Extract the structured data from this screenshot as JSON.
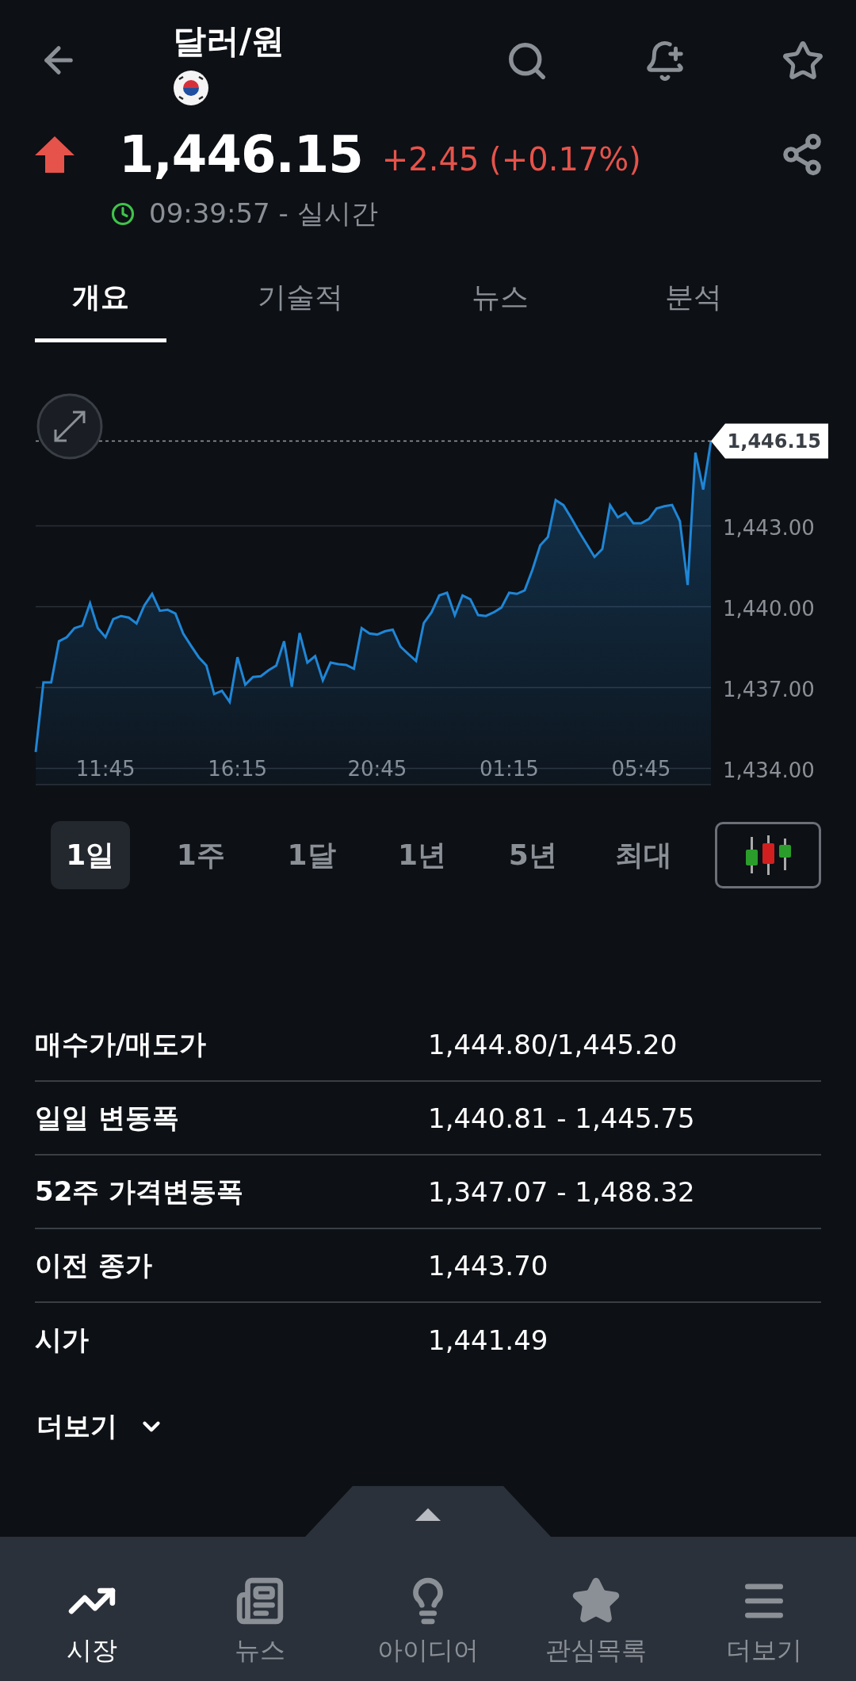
{
  "header": {
    "title": "달러/원"
  },
  "quote": {
    "rising": true,
    "price": "1,446.15",
    "change": "+2.45 (+0.17%)",
    "time": "09:39:57 - 실시간"
  },
  "tabs": [
    {
      "label": "개요",
      "selected": true
    },
    {
      "label": "기술적",
      "selected": false
    },
    {
      "label": "뉴스",
      "selected": false
    },
    {
      "label": "분석",
      "selected": false
    }
  ],
  "chart": {
    "price_tag": "1,446.15",
    "chart_data": {
      "type": "area",
      "grid": true,
      "ylim": [
        1433.4,
        1446.15
      ],
      "categories": [
        null,
        null,
        null,
        null,
        null,
        null,
        null,
        null,
        null,
        "11:45",
        null,
        null,
        null,
        null,
        null,
        null,
        null,
        null,
        null,
        null,
        null,
        null,
        null,
        null,
        null,
        null,
        "16:15",
        null,
        null,
        null,
        null,
        null,
        null,
        null,
        null,
        null,
        null,
        null,
        null,
        null,
        null,
        null,
        null,
        null,
        "20:45",
        null,
        null,
        null,
        null,
        null,
        null,
        null,
        null,
        null,
        null,
        null,
        null,
        null,
        null,
        null,
        null,
        "01:15",
        null,
        null,
        null,
        null,
        null,
        null,
        null,
        null,
        null,
        null,
        null,
        null,
        null,
        null,
        null,
        null,
        "05:45",
        null,
        null,
        null,
        null,
        null,
        null,
        null,
        null,
        null
      ],
      "yticks": [
        {
          "value": 1434,
          "label": "1,434.00"
        },
        {
          "value": 1437,
          "label": "1,437.00"
        },
        {
          "value": 1440,
          "label": "1,440.00"
        },
        {
          "value": 1443,
          "label": "1,443.00"
        }
      ],
      "series": [
        {
          "color": "#1f86d6",
          "values": [
            1434.61,
            1437.19,
            1437.19,
            1438.72,
            1438.87,
            1439.21,
            1439.3,
            1440.13,
            1439.21,
            1438.87,
            1439.54,
            1439.66,
            1439.6,
            1439.38,
            1440.05,
            1440.48,
            1439.85,
            1439.89,
            1439.75,
            1439.01,
            1438.56,
            1438.13,
            1437.82,
            1436.76,
            1436.88,
            1436.47,
            1438.13,
            1437.11,
            1437.39,
            1437.42,
            1437.64,
            1437.82,
            1438.72,
            1437.03,
            1439.03,
            1437.93,
            1438.17,
            1437.27,
            1437.93,
            1437.87,
            1437.84,
            1437.7,
            1439.21,
            1439.01,
            1438.97,
            1439.09,
            1439.15,
            1438.52,
            1438.25,
            1437.99,
            1439.4,
            1439.79,
            1440.42,
            1440.52,
            1439.69,
            1440.42,
            1440.28,
            1439.69,
            1439.66,
            1439.79,
            1439.97,
            1440.52,
            1440.48,
            1440.61,
            1441.38,
            1442.28,
            1442.59,
            1443.96,
            1443.77,
            1443.3,
            1442.79,
            1442.32,
            1441.85,
            1442.14,
            1443.77,
            1443.32,
            1443.49,
            1443.1,
            1443.1,
            1443.26,
            1443.65,
            1443.73,
            1443.78,
            1443.18,
            1440.81,
            1445.72,
            1444.35,
            1446.15
          ]
        }
      ]
    }
  },
  "ranges": [
    {
      "label": "1일",
      "selected": true
    },
    {
      "label": "1주",
      "selected": false
    },
    {
      "label": "1달",
      "selected": false
    },
    {
      "label": "1년",
      "selected": false
    },
    {
      "label": "5년",
      "selected": false
    },
    {
      "label": "최대",
      "selected": false
    }
  ],
  "stats": [
    {
      "label": "매수가/매도가",
      "value": "1,444.80/1,445.20"
    },
    {
      "label": "일일 변동폭",
      "value": "1,440.81 - 1,445.75"
    },
    {
      "label": "52주 가격변동폭",
      "value": "1,347.07 - 1,488.32"
    },
    {
      "label": "이전 종가",
      "value": "1,443.70"
    },
    {
      "label": "시가",
      "value": "1,441.49"
    }
  ],
  "more": "더보기",
  "nav": [
    {
      "kind": "market",
      "label": "시장",
      "selected": true
    },
    {
      "kind": "news",
      "label": "뉴스",
      "selected": false
    },
    {
      "kind": "idea",
      "label": "아이디어",
      "selected": false
    },
    {
      "kind": "watchlist",
      "label": "관심목록",
      "selected": false
    },
    {
      "kind": "more",
      "label": "더보기",
      "selected": false
    }
  ]
}
